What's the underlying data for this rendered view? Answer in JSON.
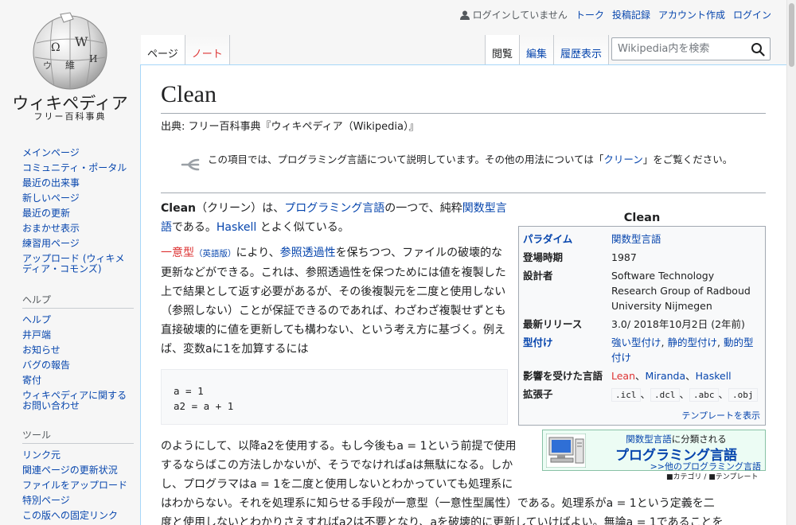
{
  "logo": {
    "wordmark": "ウィキペディア",
    "tagline": "フリー百科事典"
  },
  "nav": {
    "items": [
      "メインページ",
      "コミュニティ・ポータル",
      "最近の出来事",
      "新しいページ",
      "最近の更新",
      "おまかせ表示",
      "練習用ページ",
      "アップロード (ウィキメディア・コモンズ)"
    ]
  },
  "help": {
    "heading": "ヘルプ",
    "items": [
      "ヘルプ",
      "井戸端",
      "お知らせ",
      "バグの報告",
      "寄付",
      "ウィキペディアに関するお問い合わせ"
    ]
  },
  "tools": {
    "heading": "ツール",
    "items": [
      "リンク元",
      "関連ページの更新状況",
      "ファイルをアップロード",
      "特別ページ",
      "この版への固定リンク"
    ]
  },
  "personal": {
    "anon": "ログインしていません",
    "talk": "トーク",
    "contribs": "投稿記録",
    "create": "アカウント作成",
    "login": "ログイン"
  },
  "tabs": {
    "page": "ページ",
    "note": "ノート",
    "read": "閲覧",
    "edit": "編集",
    "history": "履歴表示"
  },
  "search": {
    "placeholder": "Wikipedia内を検索"
  },
  "article": {
    "title": "Clean",
    "site_sub": "出典: フリー百科事典『ウィキペディア（Wikipedia）』",
    "hatnote": {
      "text1": "この項目では、プログラミング言語について説明しています。その他の用法については「",
      "link": "クリーン",
      "text2": "」をご覧ください。"
    },
    "p1": {
      "bold": "Clean",
      "t1": "（クリーン）は、",
      "l1": "プログラミング言語",
      "t2": "の一つで、純粋",
      "l2": "関数型言語",
      "t3": "である。",
      "l3": "Haskell",
      "t4": " とよく似ている。"
    },
    "p2": {
      "red": "一意型",
      "small": "（英語版）",
      "t1": "により、",
      "l1": "参照透過性",
      "t2": "を保ちつつ、ファイルの破壊的な更新などができる。これは、参照透過性を保つためには値を複製した上で結果として返す必要があるが、その後複製元を二度と使用しない（参照しない）ことが保証できるのであれば、わざわざ複製せずとも直接破壊的に値を更新しても構わない、という考え方に基づく。例えば、変数aに1を加算するには"
    },
    "code": [
      "a = 1",
      "a2 = a + 1"
    ],
    "p3": [
      "のようにして、以降a2を使用する。もし今後もa = 1という前提で使用",
      "するならばこの方法しかないが、そうでなければaは無駄になる。しか",
      "し、プログラマはa = 1を二度と使用しないとわかっていても処理系に",
      "はわからない。それを処理系に知らせる手段が一意型（一意性型属性）である。処理系がa = 1という定義を二",
      "度と使用しないとわかりさえすればa2は不要となり、aを破壊的に更新していけばよい。無論a = 1であることを"
    ]
  },
  "infobox": {
    "title": "Clean",
    "paradigm_label": "パラダイム",
    "paradigm_value": "関数型言語",
    "appeared_label": "登場時期",
    "appeared_value": "1987",
    "designer_label": "設計者",
    "designer_value": "Software Technology Research Group of Radboud University Nijmegen",
    "release_label": "最新リリース",
    "release_value": "3.0/ 2018年10月2日 (2年前)",
    "typing_label": "型付け",
    "typing_1": "強い型付け",
    "typing_2": "静的型付け",
    "typing_3": "動的型付け",
    "influenced_label": "影響を受けた言語",
    "influenced_1": "Lean",
    "influenced_2": "Miranda",
    "influenced_3": "Haskell",
    "ext_label": "拡張子",
    "ext": [
      ".icl",
      ".dcl",
      ".abc",
      ".obj"
    ],
    "template_link": "テンプレートを表示"
  },
  "portal": {
    "t1_link": "関数型言語",
    "t1_text": "に分類される",
    "t2": "プログラミング言語",
    "t3": ">>他のプログラミング言語",
    "foot": "■カテゴリ / ■テンプレート"
  }
}
